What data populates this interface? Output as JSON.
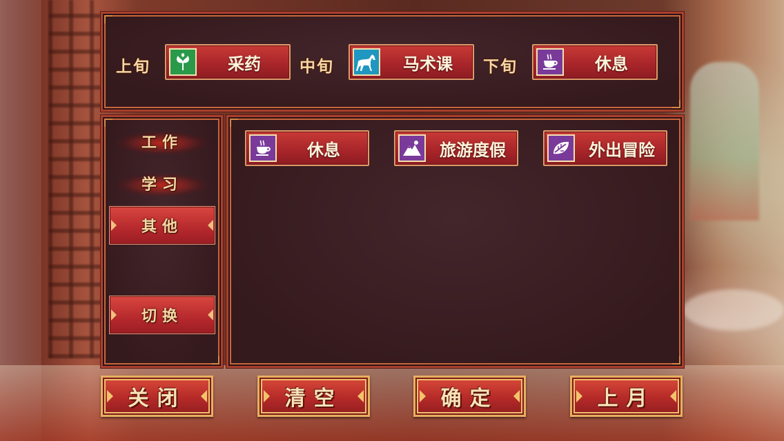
{
  "schedule": {
    "slots": [
      {
        "label": "上旬",
        "activity": "采药",
        "icon": "herb-icon",
        "icon_bg": "#2a9a4a"
      },
      {
        "label": "中旬",
        "activity": "马术课",
        "icon": "horse-icon",
        "icon_bg": "#1f97c0"
      },
      {
        "label": "下旬",
        "activity": "休息",
        "icon": "tea-cup-icon",
        "icon_bg": "#7a3a9a"
      }
    ]
  },
  "categories": {
    "work": "工作",
    "study": "学习",
    "other": "其他",
    "switch": "切换",
    "selected": "其他"
  },
  "activities": [
    {
      "label": "休息",
      "icon": "tea-cup-icon",
      "icon_bg": "#7a3a9a"
    },
    {
      "label": "旅游度假",
      "icon": "mountain-icon",
      "icon_bg": "#7a3a9a"
    },
    {
      "label": "外出冒险",
      "icon": "leaf-icon",
      "icon_bg": "#7a3a9a"
    }
  ],
  "buttons": {
    "close": "关闭",
    "clear": "清空",
    "confirm": "确定",
    "prev_month": "上月"
  }
}
